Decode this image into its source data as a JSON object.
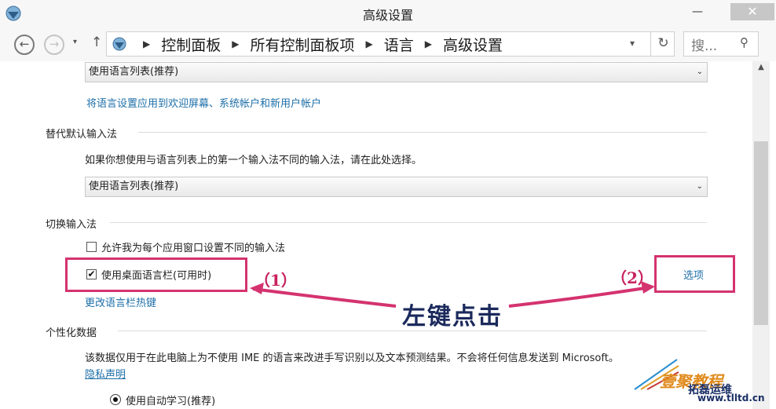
{
  "window": {
    "title": "高级设置",
    "min_label": "—",
    "close_label": "✕"
  },
  "address": {
    "crumbs": [
      "控制面板",
      "所有控制面板项",
      "语言",
      "高级设置"
    ],
    "search_placeholder": "搜..."
  },
  "content": {
    "select1_value": "使用语言列表(推荐)",
    "apply_link": "将语言设置应用到欢迎屏幕、系统帐户和新用户帐户",
    "section_override": "替代默认输入法",
    "override_desc": "如果你想使用与语言列表上的第一个输入法不同的输入法，请在此处选择。",
    "select2_value": "使用语言列表(推荐)",
    "section_switch": "切换输入法",
    "per_app_label": "允许我为每个应用窗口设置不同的输入法",
    "per_app_checked": false,
    "langbar_label": "使用桌面语言栏(可用时)",
    "langbar_checked": true,
    "options_link": "选项",
    "hotkey_link": "更改语言栏热键",
    "section_personal": "个性化数据",
    "personal_desc": "该数据仅用于在此电脑上为不使用 IME 的语言来改进手写识别以及文本预测结果。不会将任何信息发送到 Microsoft。",
    "privacy_link": "隐私声明",
    "auto_learn_label": "使用自动学习(推荐)"
  },
  "annotations": {
    "label1": "（1）",
    "label2": "（2）",
    "caption": "左键点击",
    "color": "#d4336f"
  },
  "watermark": {
    "logo": "壹聚教程",
    "logo2": "拓磊运维",
    "url": "www.tlltd.cn"
  }
}
